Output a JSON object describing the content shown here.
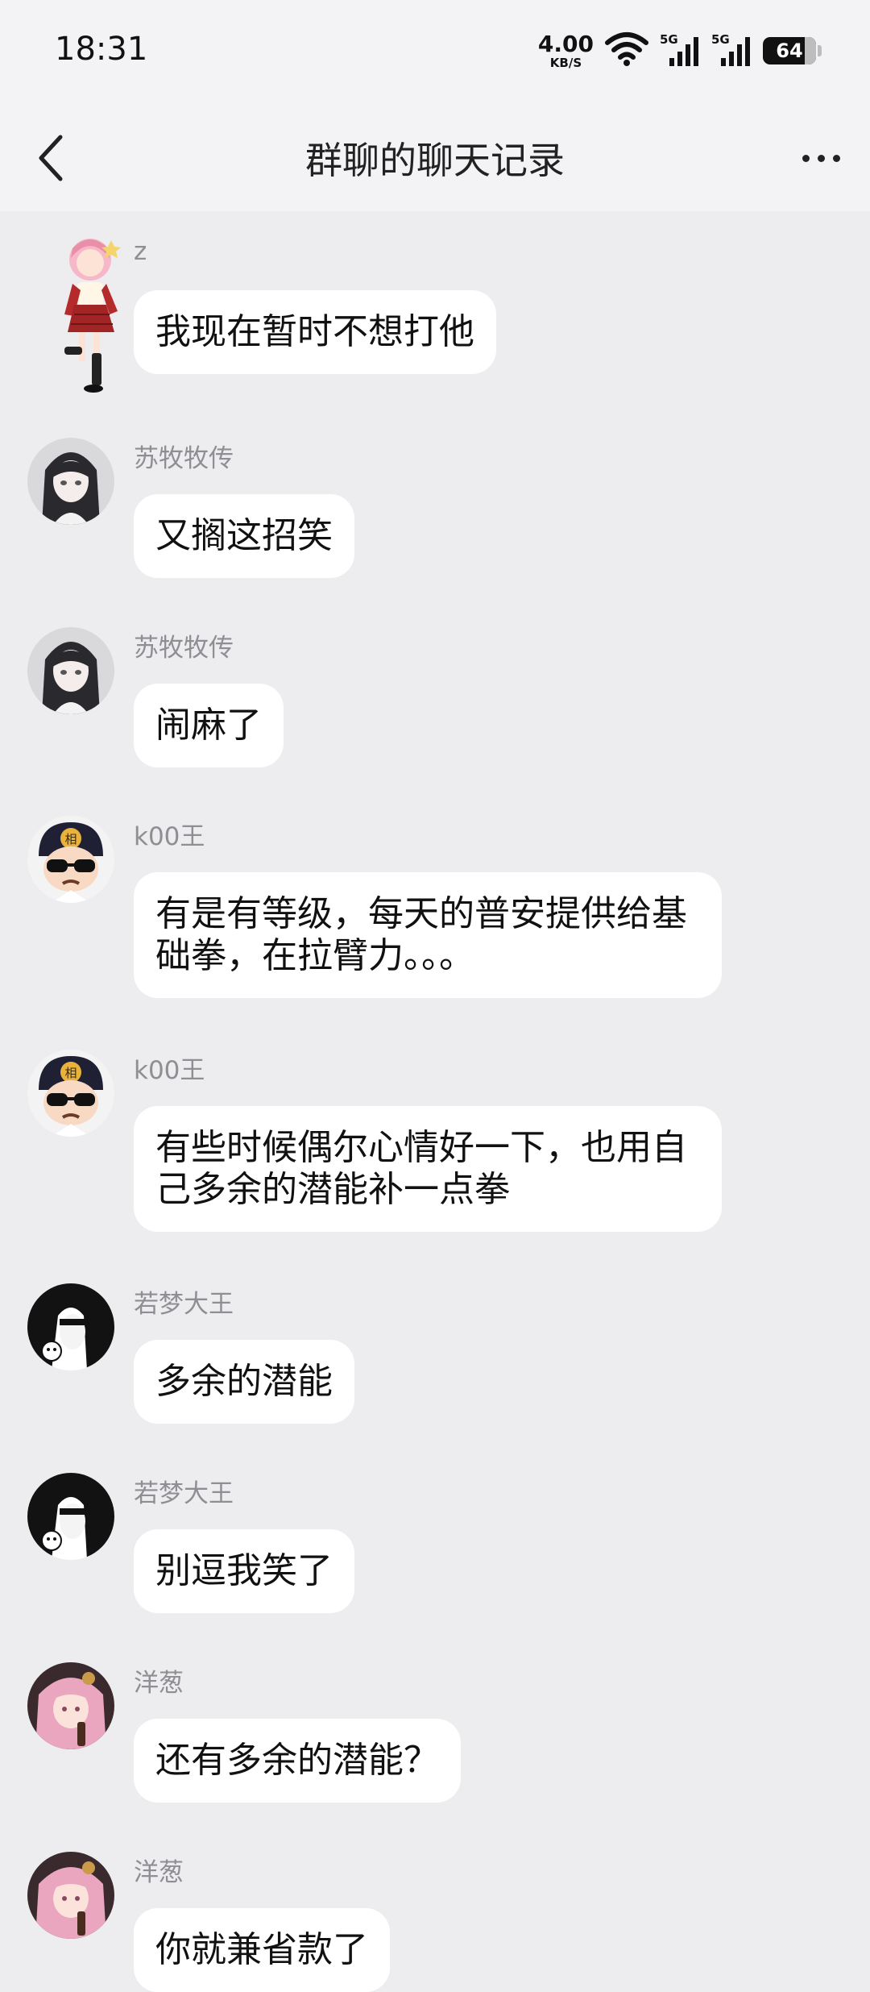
{
  "status_bar": {
    "time": "18:31",
    "net_speed_value": "4.00",
    "net_speed_unit": "KB/S",
    "sim1_label": "5G",
    "sim2_label": "5G",
    "battery_level": "64",
    "icons": [
      "wifi-icon",
      "signal-5g-icon",
      "signal-5g-icon",
      "battery-icon"
    ]
  },
  "header": {
    "title": "群聊的聊天记录",
    "back_icon": "chevron-left-icon",
    "more_icon": "more-dots-icon"
  },
  "messages": [
    {
      "sender": "z",
      "text": "我现在暂时不想打他",
      "avatar": "anime-girl-red-dress"
    },
    {
      "sender": "苏牧牧传",
      "text": "又搁这招笑",
      "avatar": "anime-girl-dark-hair"
    },
    {
      "sender": "苏牧牧传",
      "text": "闹麻了",
      "avatar": "anime-girl-dark-hair"
    },
    {
      "sender": "k00王",
      "text": "有是有等级，每天的普安提供给基础拳，在拉臂力。。。",
      "avatar": "cartoon-sunglasses-cap"
    },
    {
      "sender": "k00王",
      "text": "有些时候偶尔心情好一下，也用自己多余的潜能补一点拳",
      "avatar": "cartoon-sunglasses-cap"
    },
    {
      "sender": "若梦大王",
      "text": "多余的潜能",
      "avatar": "monochrome-manga-girl"
    },
    {
      "sender": "若梦大王",
      "text": "别逗我笑了",
      "avatar": "monochrome-manga-girl"
    },
    {
      "sender": "洋葱",
      "text": "还有多余的潜能？",
      "avatar": "pink-hair-girl"
    },
    {
      "sender": "洋葱",
      "text": "你就兼省款了",
      "avatar": "pink-hair-girl"
    }
  ],
  "colors": {
    "background": "#EDEDF0",
    "header_bg": "#F3F3F6",
    "bubble_bg": "#FFFFFF",
    "sender_name": "#8E8E93",
    "text": "#111111"
  }
}
